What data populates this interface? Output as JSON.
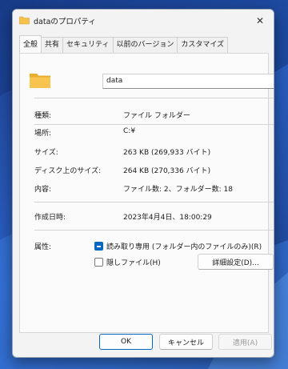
{
  "window": {
    "title": "dataのプロパティ",
    "close_glyph": "✕"
  },
  "tabs": [
    {
      "label": "全般",
      "active": true
    },
    {
      "label": "共有",
      "active": false
    },
    {
      "label": "セキュリティ",
      "active": false
    },
    {
      "label": "以前のバージョン",
      "active": false
    },
    {
      "label": "カスタマイズ",
      "active": false
    }
  ],
  "general": {
    "name_value": "data",
    "rows": [
      {
        "label": "種類:",
        "value": "ファイル フォルダー"
      },
      {
        "label": "場所:",
        "value": "C:¥"
      },
      {
        "label": "サイズ:",
        "value": "263 KB (269,933 バイト)"
      },
      {
        "label": "ディスク上のサイズ:",
        "value": "264 KB (270,336 バイト)"
      },
      {
        "label": "内容:",
        "value": "ファイル数: 2、フォルダー数: 18"
      },
      {
        "label": "作成日時:",
        "value": "2023年4月4日、18:00:29"
      }
    ],
    "attributes_label": "属性:",
    "readonly_label": "読み取り専用 (フォルダー内のファイルのみ)(R)",
    "hidden_label": "隠しファイル(H)",
    "advanced_button": "詳細設定(D)..."
  },
  "footer": {
    "ok": "OK",
    "cancel": "キャンセル",
    "apply": "適用(A)"
  },
  "icons": {
    "folder": "folder-icon",
    "close": "close-icon"
  },
  "colors": {
    "accent": "#0067c0",
    "folder": "#f5c14a"
  }
}
